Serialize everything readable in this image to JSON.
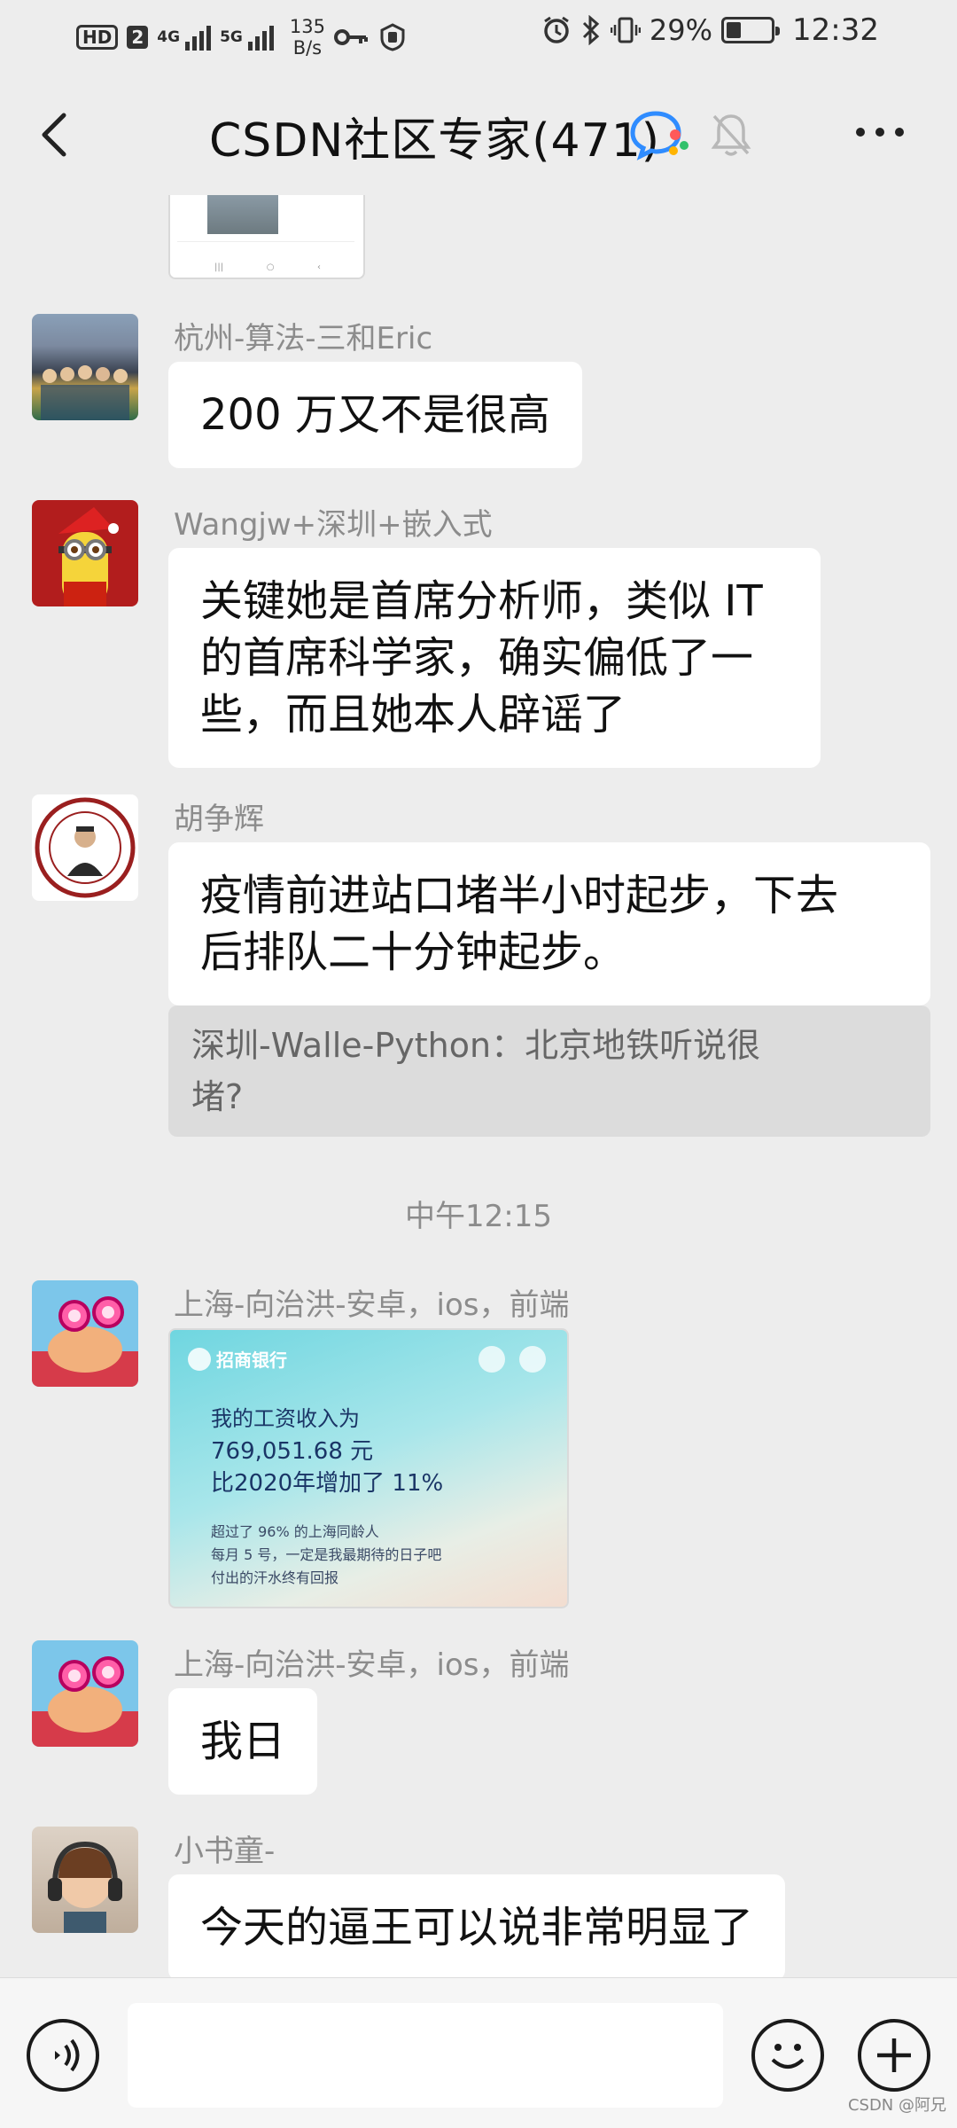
{
  "status_bar": {
    "hd_label": "HD",
    "sim_label": "2",
    "net_1": "4G",
    "net_2": "5G",
    "speed_value": "135",
    "speed_unit": "B/s",
    "battery": "29%",
    "time": "12:32"
  },
  "header": {
    "title": "CSDN社区专家(471)"
  },
  "messages": [
    {
      "sender": "杭州-算法-三和Eric",
      "text": "200 万又不是很高"
    },
    {
      "sender": "Wangjw+深圳+嵌入式",
      "lines": [
        "关键她是首席分析师，类似 IT",
        "的首席科学家，确实偏低了一",
        "些，而且她本人辟谣了"
      ]
    },
    {
      "sender": "胡争辉",
      "lines": [
        "疫情前进站口堵半小时起步，下去",
        "后排队二十分钟起步。"
      ],
      "quote_lines": [
        "深圳-Walle-Python：北京地铁听说很",
        "堵?"
      ]
    },
    {
      "sender": "上海-向治洪-安卓，ios，前端"
    },
    {
      "sender": "上海-向治洪-安卓，ios，前端",
      "text": "我日"
    },
    {
      "sender": "小书童-",
      "text": "今天的逼王可以说非常明显了"
    }
  ],
  "timestamp": "中午12:15",
  "bank_card": {
    "bank_name": "招商银行",
    "line1": "我的工资收入为",
    "line2": "769,051.68 元",
    "line3": "比2020年增加了 11%",
    "small1": "超过了 96% 的上海同龄人",
    "small2": "每月 5 号，一定是我最期待的日子吧",
    "small3": "付出的汗水终有回报"
  },
  "watermark": "CSDN @阿兄",
  "colors": {
    "background": "#ededed",
    "bubble": "#ffffff",
    "quote": "#dcdcdc",
    "sender_text": "#8c8c8c"
  },
  "icons": [
    "back-arrow-icon",
    "chat-bubbles-icon",
    "mute-bell-icon",
    "more-dots-icon",
    "voice-icon",
    "emoji-icon",
    "plus-icon"
  ]
}
